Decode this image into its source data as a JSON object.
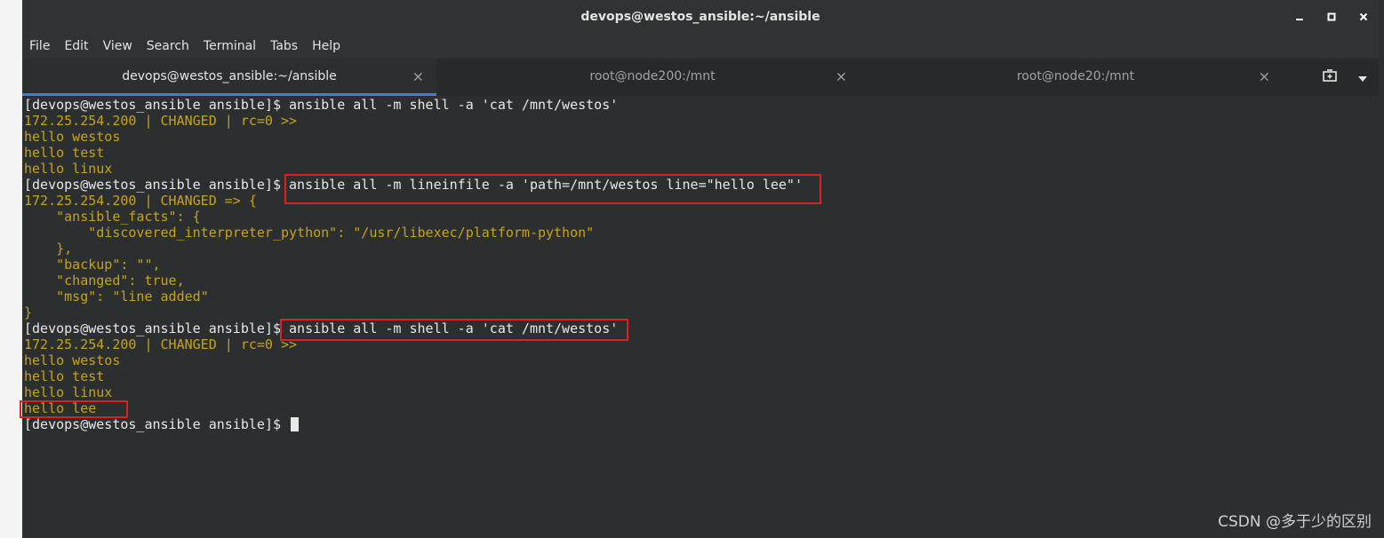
{
  "window": {
    "title": "devops@westos_ansible:~/ansible"
  },
  "menu": [
    "File",
    "Edit",
    "View",
    "Search",
    "Terminal",
    "Tabs",
    "Help"
  ],
  "tabs": [
    {
      "label": "devops@westos_ansible:~/ansible",
      "active": true,
      "close": "×"
    },
    {
      "label": "root@node200:/mnt",
      "active": false,
      "close": "×"
    },
    {
      "label": "root@node20:/mnt",
      "active": false,
      "close": "×"
    }
  ],
  "terminal": {
    "lines": [
      {
        "kind": "prompt",
        "text": "[devops@westos_ansible ansible]$ ansible all -m shell -a 'cat /mnt/westos'"
      },
      {
        "kind": "out",
        "text": "172.25.254.200 | CHANGED | rc=0 >>"
      },
      {
        "kind": "out",
        "text": "hello westos"
      },
      {
        "kind": "out",
        "text": "hello test"
      },
      {
        "kind": "out",
        "text": "hello linux"
      },
      {
        "kind": "prompt",
        "text": "[devops@westos_ansible ansible]$ ansible all -m lineinfile -a 'path=/mnt/westos line=\"hello lee\"'"
      },
      {
        "kind": "out",
        "text": "172.25.254.200 | CHANGED => {"
      },
      {
        "kind": "out",
        "text": "    \"ansible_facts\": {"
      },
      {
        "kind": "out",
        "text": "        \"discovered_interpreter_python\": \"/usr/libexec/platform-python\""
      },
      {
        "kind": "out",
        "text": "    },"
      },
      {
        "kind": "out",
        "text": "    \"backup\": \"\","
      },
      {
        "kind": "out",
        "text": "    \"changed\": true,"
      },
      {
        "kind": "out",
        "text": "    \"msg\": \"line added\""
      },
      {
        "kind": "out",
        "text": "}"
      },
      {
        "kind": "prompt",
        "text": "[devops@westos_ansible ansible]$ ansible all -m shell -a 'cat /mnt/westos'"
      },
      {
        "kind": "out",
        "text": "172.25.254.200 | CHANGED | rc=0 >>"
      },
      {
        "kind": "out",
        "text": "hello westos"
      },
      {
        "kind": "out",
        "text": "hello test"
      },
      {
        "kind": "out",
        "text": "hello linux"
      },
      {
        "kind": "out",
        "text": "hello lee"
      }
    ],
    "final_prompt": "[devops@westos_ansible ansible]$ "
  },
  "watermark": "CSDN @多于少的区别",
  "colors": {
    "prompt": "#e8e8e8",
    "output": "#c9a21a",
    "highlight": "#e02020",
    "tab_accent": "#3d7fd6"
  }
}
